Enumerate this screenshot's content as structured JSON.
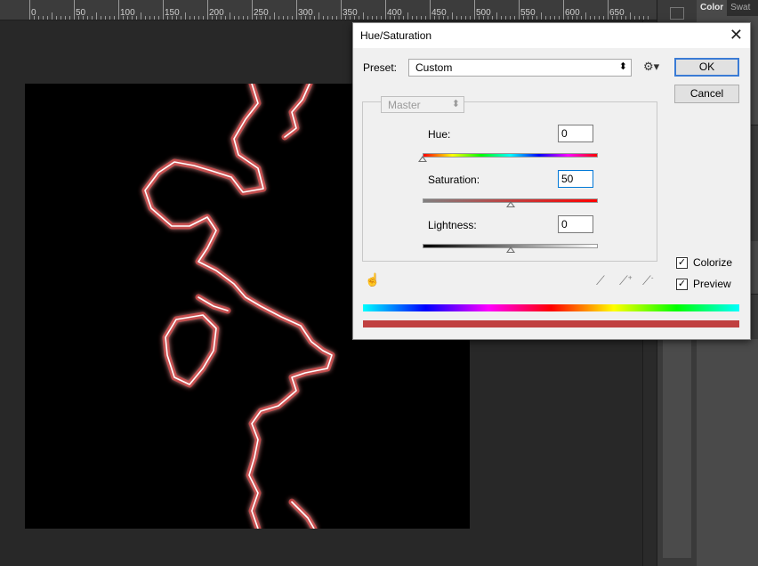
{
  "ruler": {
    "labels": [
      "0",
      "50",
      "100",
      "150",
      "200",
      "250",
      "300",
      "350",
      "400",
      "450",
      "500",
      "550",
      "600",
      "650"
    ]
  },
  "panel": {
    "tab_color": "Color",
    "tab_swatches": "Swat"
  },
  "dialog": {
    "title": "Hue/Saturation",
    "preset_label": "Preset:",
    "preset_value": "Custom",
    "ok_label": "OK",
    "cancel_label": "Cancel",
    "channel_value": "Master",
    "hue": {
      "label": "Hue:",
      "value": "0"
    },
    "saturation": {
      "label": "Saturation:",
      "value": "50"
    },
    "lightness": {
      "label": "Lightness:",
      "value": "0"
    },
    "colorize": {
      "label": "Colorize",
      "checked": true
    },
    "preview": {
      "label": "Preview",
      "checked": true
    },
    "slider_levels": {
      "hue": 0,
      "saturation": 50,
      "lightness": 50
    }
  },
  "colors": {
    "glow": "#ff6a6a",
    "core": "#ffffff",
    "colorize_bar": "#c04040"
  },
  "icons": {
    "preset_options": "gear-icon",
    "targeted_adjust": "hand-icon",
    "eyedropper": "eyedropper-icon",
    "add_eyedropper": "eyedropper-plus-icon",
    "sub_eyedropper": "eyedropper-minus-icon",
    "close": "close-icon"
  }
}
